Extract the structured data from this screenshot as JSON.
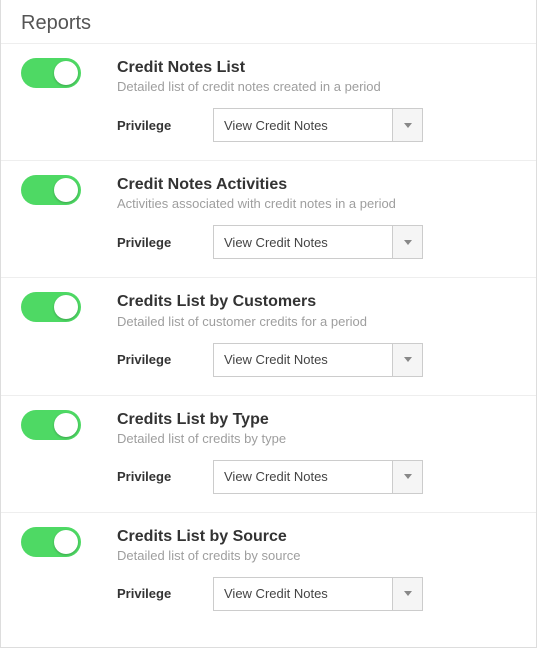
{
  "section_title": "Reports",
  "privilege_label": "Privilege",
  "reports": [
    {
      "title": "Credit Notes List",
      "description": "Detailed list of credit notes created in a period",
      "privilege_value": "View Credit Notes",
      "enabled": true
    },
    {
      "title": "Credit Notes Activities",
      "description": "Activities associated with credit notes in a period",
      "privilege_value": "View Credit Notes",
      "enabled": true
    },
    {
      "title": "Credits List by Customers",
      "description": "Detailed list of customer credits for a period",
      "privilege_value": "View Credit Notes",
      "enabled": true
    },
    {
      "title": "Credits List by Type",
      "description": "Detailed list of credits by type",
      "privilege_value": "View Credit Notes",
      "enabled": true
    },
    {
      "title": "Credits List by Source",
      "description": "Detailed list of credits by source",
      "privilege_value": "View Credit Notes",
      "enabled": true
    }
  ]
}
